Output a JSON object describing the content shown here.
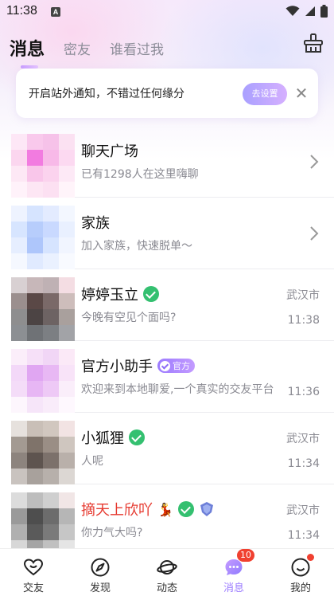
{
  "status_bar": {
    "time": "11:38",
    "app_badge": "A"
  },
  "top_tabs": [
    {
      "label": "消息",
      "active": true
    },
    {
      "label": "密友",
      "active": false
    },
    {
      "label": "谁看过我",
      "active": false
    }
  ],
  "notice": {
    "text": "开启站外通知，不错过任何缘分",
    "button": "去设置",
    "close": "✕"
  },
  "conversations": [
    {
      "name": "聊天广场",
      "preview": "已有1298人在这里嗨聊",
      "type": "entry",
      "avatar_colors": [
        "#fde7f6",
        "#f9c9ec",
        "#f6c2e9",
        "#fbe1f2",
        "#fbd6ef",
        "#f27be0",
        "#f8b9e8",
        "#fcd9f1",
        "#fde8f5",
        "#f9c6ea",
        "#fbd3ee",
        "#fde9f6",
        "#fff2fa",
        "#fde6f4",
        "#fce0f2",
        "#fff4fa"
      ]
    },
    {
      "name": "家族",
      "preview": "加入家族，快速脱单～",
      "type": "entry",
      "avatar_colors": [
        "#eef3ff",
        "#d6e4ff",
        "#e3ebff",
        "#f3f7ff",
        "#d7e5ff",
        "#b7cdfc",
        "#c9d9ff",
        "#e9f0ff",
        "#e6eeff",
        "#aec6fb",
        "#d6e4ff",
        "#f1f5ff",
        "#f5f8ff",
        "#e0eaff",
        "#eaf1ff",
        "#f8faff"
      ]
    },
    {
      "name": "婷婷玉立",
      "preview": "今晚有空见个面吗?",
      "city": "武汉市",
      "time": "11:38",
      "verified": true,
      "avatar_colors": [
        "#d8d0d2",
        "#c7b7b9",
        "#bfb1b4",
        "#f4dde3",
        "#9b8f8e",
        "#5a4846",
        "#7a6968",
        "#cdbdbb",
        "#8e8e8f",
        "#4c4444",
        "#6d6363",
        "#a9a09d",
        "#8c8f93",
        "#6f7276",
        "#7c7f83",
        "#a2a3a7"
      ]
    },
    {
      "name": "官方小助手",
      "preview": "欢迎来到本地聊爱,一个真实的交友平台",
      "time": "11:36",
      "official": "官方",
      "avatar_colors": [
        "#fbeefa",
        "#f6e0f8",
        "#f1d6f6",
        "#fbe9f7",
        "#f3d8f8",
        "#e0a6f2",
        "#e8b8f4",
        "#f8e3f8",
        "#f4dcf8",
        "#e7b6f4",
        "#eec9f6",
        "#faeefa",
        "#fdf6fd",
        "#f6e5f9",
        "#f9ecfa",
        "#fef8fe"
      ]
    },
    {
      "name": "小狐狸",
      "preview": "人呢",
      "city": "武汉市",
      "time": "11:34",
      "verified": true,
      "avatar_colors": [
        "#e6e1dd",
        "#c9bfb7",
        "#d1c7bf",
        "#f2e3e3",
        "#a39a92",
        "#7f736a",
        "#9a8e85",
        "#cfc6bf",
        "#8d847e",
        "#5e544f",
        "#7c716b",
        "#b9b0aa",
        "#c9c3bf",
        "#a8a19c",
        "#b7b0ab",
        "#dcd7d3"
      ]
    },
    {
      "name": "摘天上欣吖",
      "preview": "你力气大吗?",
      "city": "武汉市",
      "time": "11:34",
      "verified": true,
      "vip": true,
      "name_color": "red",
      "emoji": "💃",
      "avatar_colors": [
        "#dcdcdc",
        "#bdbdbd",
        "#cfcfcf",
        "#f1e6e6",
        "#9a9a9a",
        "#4e4e4e",
        "#6c6c6c",
        "#b6b6b6",
        "#b0b0b0",
        "#5a5a5a",
        "#7a7a7a",
        "#c6c6c6",
        "#d7d7d7",
        "#a5a5a5",
        "#c0c0c0",
        "#e5e5e5"
      ]
    }
  ],
  "bottom_nav": [
    {
      "label": "交友",
      "icon": "heart-icon"
    },
    {
      "label": "发现",
      "icon": "compass-icon"
    },
    {
      "label": "动态",
      "icon": "planet-icon"
    },
    {
      "label": "消息",
      "icon": "message-icon",
      "active": true,
      "badge": "10"
    },
    {
      "label": "我的",
      "icon": "profile-icon",
      "dot": true
    }
  ],
  "colors": {
    "accent": "#9b7bff",
    "badge": "#f04030",
    "verified": "#34c070",
    "red_name": "#e6392f"
  }
}
